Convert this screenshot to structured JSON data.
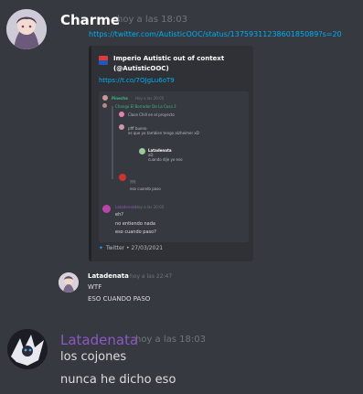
{
  "messages": [
    {
      "username": "Charme",
      "timestamp": "hoy a las 18:03",
      "link": "https://twitter.com/AutisticOOC/status/1375931123860185089?s=20",
      "embed": {
        "author": "Imperio Autistic out of context (@AutisticOOC)",
        "short_link": "https://t.co/7OJgLu6oT9",
        "footer": "Twitter • 27/03/2021",
        "image": {
          "rows": [
            {
              "name": "Pinecha",
              "meta": "Hoy a las 20:05",
              "text": "",
              "color": "#43b581"
            },
            {
              "name": "",
              "meta": "",
              "text": "Chango El Borrador De La Cosa 3",
              "color": "#43b581"
            },
            {
              "name": "",
              "meta": "",
              "text": "Clase Chill en el proyecto",
              "color": "#b9bbbe"
            },
            {
              "name": "",
              "meta": "",
              "text": "pfff bueno",
              "color": "#b9bbbe"
            },
            {
              "name": "",
              "meta": "",
              "text": "es que yo tambien tengo alzheimer xD",
              "color": "#b9bbbe"
            },
            {
              "name": "Latadenata",
              "meta": "Hoy a las 20:05",
              "text": "xD",
              "color": "#b9bbbe"
            },
            {
              "name": "",
              "meta": "",
              "text": "cuando dije yo eso",
              "color": "#b9bbbe"
            },
            {
              "name": "",
              "meta": "",
              "text": "???",
              "color": "#b9bbbe"
            },
            {
              "name": "",
              "meta": "",
              "text": "eso cuando paso",
              "color": "#b9bbbe"
            },
            {
              "name": "Latadenata",
              "meta": "Hoy a las 20:05",
              "text": "eh?",
              "color": "#8e58c4"
            },
            {
              "name": "",
              "meta": "",
              "text": "no entiendo nada",
              "color": "#dcddde"
            },
            {
              "name": "",
              "meta": "",
              "text": "eso cuando paso?",
              "color": "#dcddde"
            }
          ]
        }
      }
    },
    {
      "username": "Latadenata",
      "timestamp": "hoy a las 22:47",
      "lines": [
        "WTF",
        "ESO CUANDO PASO"
      ]
    },
    {
      "username": "Latadenata",
      "timestamp": "hoy a las 18:03",
      "lines": [
        "los cojones",
        "nunca he dicho eso"
      ]
    }
  ],
  "colors": {
    "background": "#36393f",
    "embed_bg": "#2f3136",
    "link": "#00aff4",
    "username_default": "#ffffff",
    "username_purple": "#8e58c4",
    "timestamp": "#72767d"
  }
}
